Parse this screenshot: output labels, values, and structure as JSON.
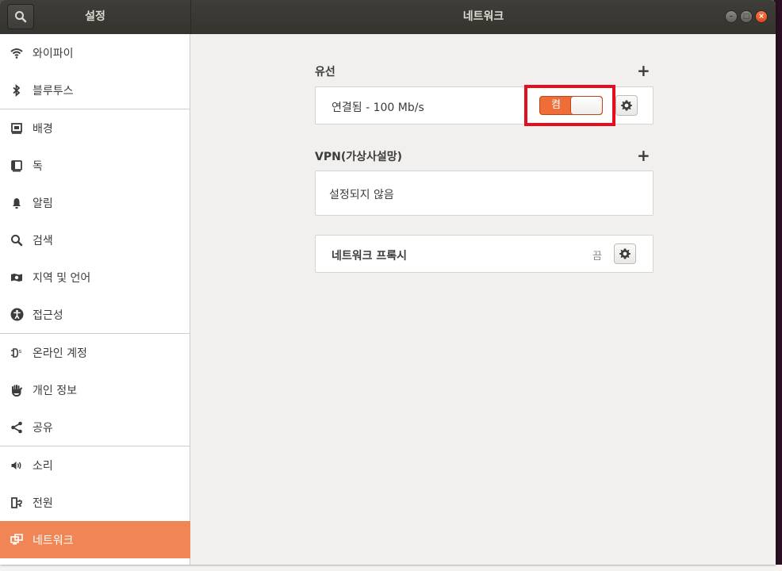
{
  "titlebar": {
    "sidebar_title": "설정",
    "main_title": "네트워크"
  },
  "sidebar": {
    "items": [
      {
        "label": "와이파이",
        "icon": "wifi-icon"
      },
      {
        "label": "블루투스",
        "icon": "bluetooth-icon"
      },
      {
        "label": "배경",
        "icon": "background-icon"
      },
      {
        "label": "독",
        "icon": "dock-icon"
      },
      {
        "label": "알림",
        "icon": "bell-icon"
      },
      {
        "label": "검색",
        "icon": "search-icon"
      },
      {
        "label": "지역 및 언어",
        "icon": "region-icon"
      },
      {
        "label": "접근성",
        "icon": "accessibility-icon"
      },
      {
        "label": "온라인 계정",
        "icon": "online-accounts-icon"
      },
      {
        "label": "개인 정보",
        "icon": "privacy-hand-icon"
      },
      {
        "label": "공유",
        "icon": "share-icon"
      },
      {
        "label": "소리",
        "icon": "speaker-icon"
      },
      {
        "label": "전원",
        "icon": "power-icon"
      },
      {
        "label": "네트워크",
        "icon": "network-icon",
        "selected": true
      }
    ]
  },
  "wired": {
    "title": "유선",
    "status": "연결됨 - 100 Mb/s",
    "toggle_label": "켬",
    "toggle_on": true
  },
  "vpn": {
    "title": "VPN(가상사설망)",
    "status": "설정되지 않음"
  },
  "proxy": {
    "title": "네트워크 프록시",
    "state": "끔"
  },
  "colors": {
    "accent": "#f08655",
    "toggle_on": "#ef6d39",
    "highlight_box": "#e50e1c"
  }
}
